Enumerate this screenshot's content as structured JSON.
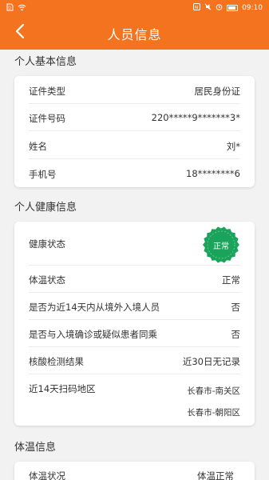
{
  "status_bar": {
    "time": "09:10"
  },
  "nav": {
    "title": "人员信息"
  },
  "basic": {
    "title": "个人基本信息",
    "rows": [
      {
        "label": "证件类型",
        "value": "居民身份证"
      },
      {
        "label": "证件号码",
        "value": "220*****9*******3*"
      },
      {
        "label": "姓名",
        "value": "刘*"
      },
      {
        "label": "手机号",
        "value": "18********6"
      }
    ]
  },
  "health": {
    "title": "个人健康信息",
    "status_label": "健康状态",
    "status_badge": "正常",
    "badge_color": "#1aa35a",
    "rows": [
      {
        "label": "体温状态",
        "value": "正常"
      },
      {
        "label": "是否为近14天内从境外入境人员",
        "value": "否"
      },
      {
        "label": "是否与入境确诊或疑似患者同乘",
        "value": "否"
      },
      {
        "label": "核酸检测结果",
        "value": "近30日无记录"
      }
    ],
    "scan_label": "近14天扫码地区",
    "scan_areas": [
      "长春市-南关区",
      "长春市-朝阳区"
    ]
  },
  "temperature": {
    "title": "体温信息",
    "row_label": "体温状况",
    "row_value": "体温正常"
  },
  "colors": {
    "header": "#f4731e"
  }
}
